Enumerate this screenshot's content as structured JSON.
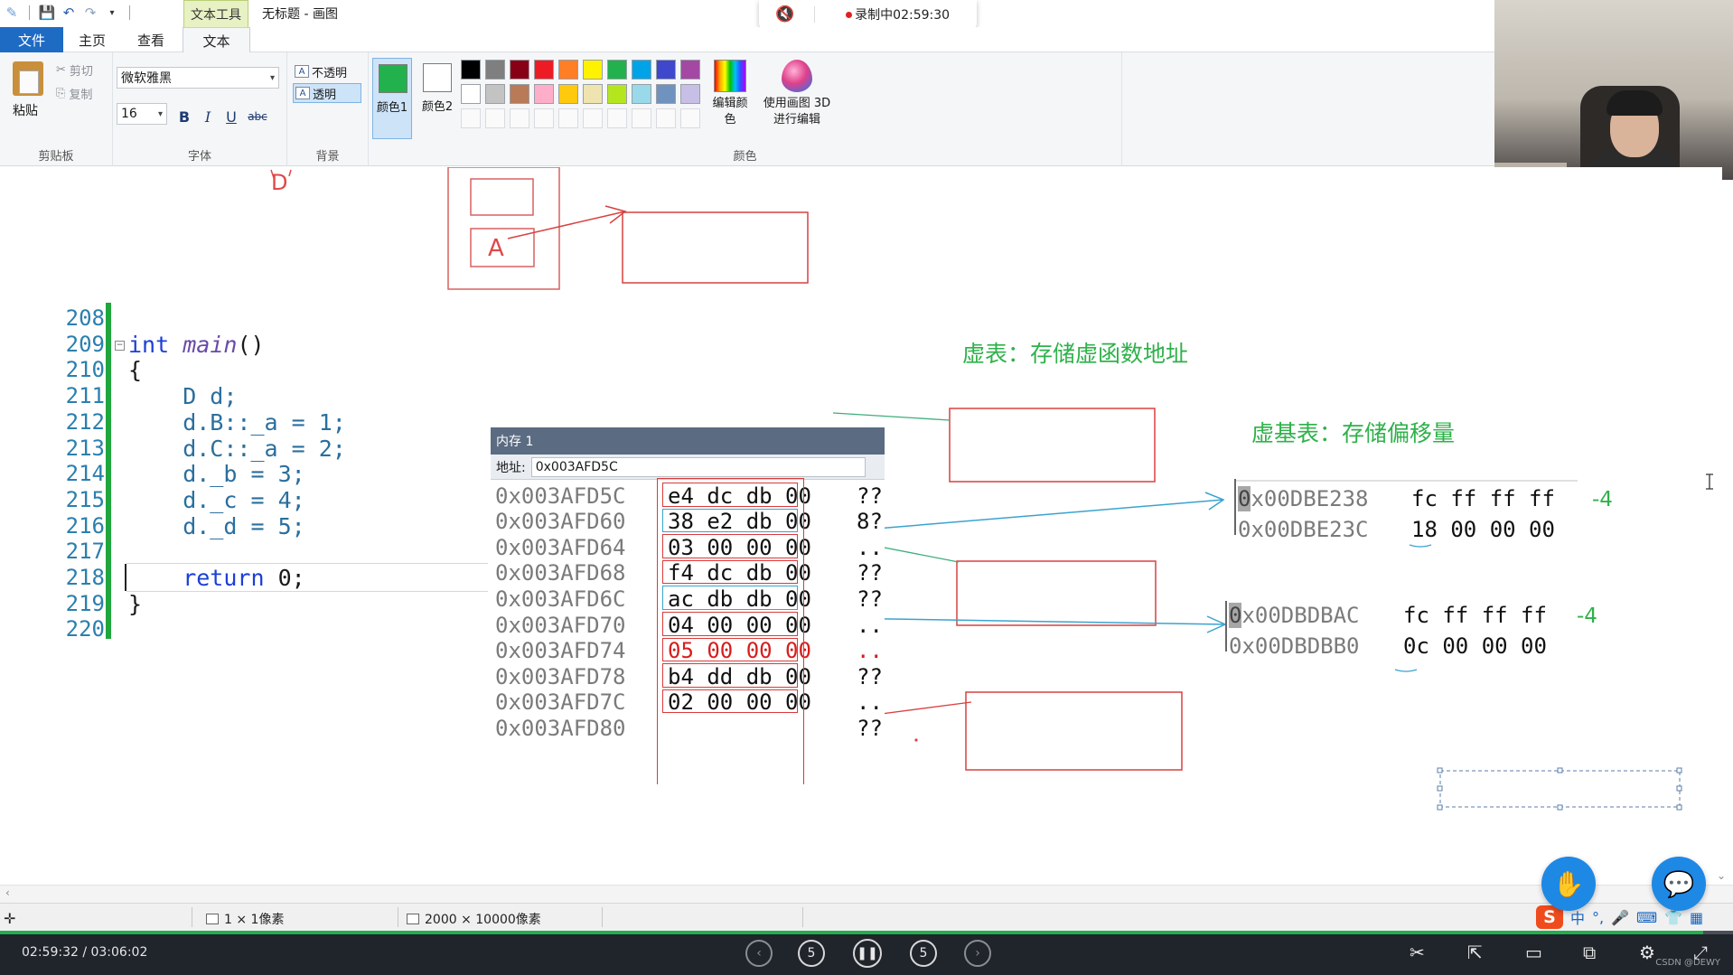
{
  "titlebar": {
    "context_tool": "文本工具",
    "doc_title": "无标题 - 画图",
    "recording": "录制中02:59:30"
  },
  "tabs": {
    "file": "文件",
    "home": "主页",
    "view": "查看",
    "text": "文本"
  },
  "ribbon": {
    "clipboard": {
      "paste": "粘贴",
      "cut": "剪切",
      "copy": "复制",
      "label": "剪贴板"
    },
    "font": {
      "family": "微软雅黑",
      "size": "16",
      "bold": "B",
      "italic": "I",
      "underline": "U",
      "strike": "abc",
      "label": "字体"
    },
    "background": {
      "opaque": "不透明",
      "transparent": "透明",
      "label": "背景"
    },
    "colors": {
      "color1_label": "颜色1",
      "color2_label": "颜色2",
      "color1_value": "#22b14c",
      "color2_value": "#ffffff",
      "edit_colors": "编辑颜色",
      "paint3d": "使用画图 3D 进行编辑",
      "label": "颜色",
      "palette_row1": [
        "#000000",
        "#7f7f7f",
        "#880015",
        "#ed1c24",
        "#ff7f27",
        "#fff200",
        "#22b14c",
        "#00a2e8",
        "#3f48cc",
        "#a349a4"
      ],
      "palette_row2": [
        "#ffffff",
        "#c3c3c3",
        "#b97a57",
        "#ffaec9",
        "#ffc90e",
        "#efe4b0",
        "#b5e61d",
        "#99d9ea",
        "#7092be",
        "#c8bfe7"
      ]
    }
  },
  "canvas": {
    "drawing_letters": {
      "d": "D",
      "a": "A"
    },
    "labels": {
      "vtable": "虚表：存储虚函数地址",
      "vbtable": "虚基表：存储偏移量"
    }
  },
  "code": {
    "lines": [
      {
        "num": "208",
        "text": ""
      },
      {
        "num": "209",
        "text": ""
      },
      {
        "num": "210",
        "text": "{"
      },
      {
        "num": "211",
        "text": "    D d;"
      },
      {
        "num": "212",
        "text": "    d.B::_a = 1;"
      },
      {
        "num": "213",
        "text": "    d.C::_a = 2;"
      },
      {
        "num": "214",
        "text": "    d._b = 3;"
      },
      {
        "num": "215",
        "text": "    d._c = 4;"
      },
      {
        "num": "216",
        "text": "    d._d = 5;"
      },
      {
        "num": "217",
        "text": ""
      },
      {
        "num": "218",
        "text": ""
      },
      {
        "num": "219",
        "text": "}"
      },
      {
        "num": "220",
        "text": ""
      }
    ],
    "main_kw": "int",
    "main_fn": "main",
    "main_parens": "()",
    "return_kw": "return",
    "return_val": " 0;"
  },
  "memory": {
    "title": "内存 1",
    "addr_label": "地址:",
    "addr_value": "0x003AFD5C",
    "rows": [
      {
        "addr": "0x003AFD5C",
        "bytes": "e4 dc db 00",
        "ascii": "??"
      },
      {
        "addr": "0x003AFD60",
        "bytes": "38 e2 db 00",
        "ascii": "8?"
      },
      {
        "addr": "0x003AFD64",
        "bytes": "03 00 00 00",
        "ascii": ".."
      },
      {
        "addr": "0x003AFD68",
        "bytes": "f4 dc db 00",
        "ascii": "??"
      },
      {
        "addr": "0x003AFD6C",
        "bytes": "ac db db 00",
        "ascii": "??"
      },
      {
        "addr": "0x003AFD70",
        "bytes": "04 00 00 00",
        "ascii": ".."
      },
      {
        "addr": "0x003AFD74",
        "bytes": "05 00 00 00",
        "ascii": ".."
      },
      {
        "addr": "0x003AFD78",
        "bytes": "b4 dd db 00",
        "ascii": "??"
      },
      {
        "addr": "0x003AFD7C",
        "bytes": "02 00 00 00",
        "ascii": ".."
      },
      {
        "addr": "0x003AFD80",
        "bytes": "",
        "ascii": "??"
      }
    ]
  },
  "vbtables": {
    "t1": [
      {
        "first": "0",
        "addr": "x00DBE238",
        "bytes": "fc ff ff ff",
        "note": "-4"
      },
      {
        "first": "",
        "addr": "0x00DBE23C",
        "bytes": "18 00 00 00",
        "note": ""
      }
    ],
    "t2": [
      {
        "first": "0",
        "addr": "x00DBDBAC",
        "bytes": "fc ff ff ff",
        "note": "-4"
      },
      {
        "first": "",
        "addr": "0x00DBDBB0",
        "bytes": "0c 00 00 00",
        "note": ""
      }
    ]
  },
  "statusbar": {
    "selection": "1 × 1像素",
    "canvas_size": "2000 × 10000像素",
    "ime_lang": "中"
  },
  "player": {
    "time": "02:59:32  /  03:06:02",
    "progress_fraction": 0.9826,
    "back5": "5",
    "fwd5": "5",
    "watermark": "CSDN @DEWY"
  }
}
